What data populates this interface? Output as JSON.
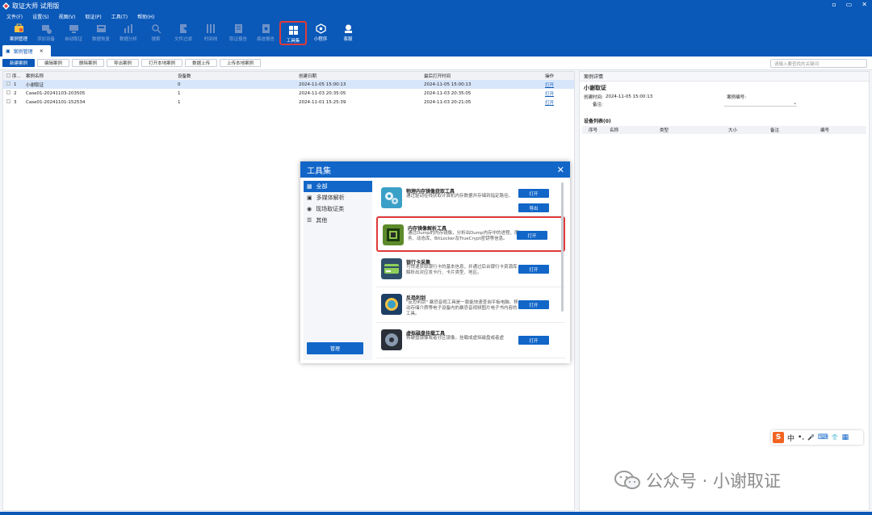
{
  "window": {
    "title": "取证大师 试用版",
    "controls": [
      "▫",
      "▭",
      "✕"
    ]
  },
  "menu": [
    "文件(F)",
    "设置(S)",
    "视图(V)",
    "取证(P)",
    "工具(T)",
    "帮助(H)"
  ],
  "toolbar": [
    {
      "label": "案例管理",
      "icon": "case-management-icon",
      "dim": false
    },
    {
      "label": "添加设备",
      "icon": "add-device-icon",
      "dim": true
    },
    {
      "label": "自动取证",
      "icon": "auto-forensics-icon",
      "dim": true
    },
    {
      "label": "数据恢复",
      "icon": "data-recovery-icon",
      "dim": true
    },
    {
      "label": "数据分析",
      "icon": "data-analysis-icon",
      "dim": true
    },
    {
      "label": "搜索",
      "icon": "search-icon",
      "dim": true
    },
    {
      "label": "文件过滤",
      "icon": "file-filter-icon",
      "dim": true
    },
    {
      "label": "时间线",
      "icon": "timeline-icon",
      "dim": true
    },
    {
      "label": "取证报告",
      "icon": "report-icon",
      "dim": true
    },
    {
      "label": "痕迹报告",
      "icon": "trace-report-icon",
      "dim": true
    },
    {
      "label": "工具集",
      "icon": "toolset-icon",
      "dim": false
    },
    {
      "label": "小程序",
      "icon": "miniprogram-icon",
      "dim": false
    },
    {
      "label": "客服",
      "icon": "customer-service-icon",
      "dim": false
    }
  ],
  "tab": {
    "label": "案例管理"
  },
  "actions": [
    "新建案例",
    "编辑案例",
    "删除案例",
    "导出案例",
    "打开本地案例",
    "数据上传",
    "上传本地案例"
  ],
  "search_placeholder": "请输入要查找的关键词",
  "case_table": {
    "columns": [
      "序...",
      "案例名称",
      "设备数",
      "创建日期",
      "最后打开时间",
      "操作"
    ],
    "rows": [
      [
        "1",
        "小谢取证",
        "0",
        "2024-11-05 15:00:13",
        "2024-11-05 15:00:13",
        "打开"
      ],
      [
        "2",
        "Case01-20241103-203505",
        "1",
        "2024-11-03 20:35:05",
        "2024-11-03 20:35:05",
        "打开"
      ],
      [
        "3",
        "Case01-20241101-152534",
        "1",
        "2024-11-01 15:25:39",
        "2024-11-03 20:21:05",
        "打开"
      ]
    ]
  },
  "detail": {
    "header": "案例详情",
    "name": "小谢取证",
    "created_label": "创建时间:",
    "created_value": "2024-11-05 15:00:13",
    "number_label": "案例编号:",
    "note_label": "备注:",
    "devices_label": "设备列表(0)",
    "device_columns": [
      "序号",
      "名称",
      "类型",
      "大小",
      "备注",
      "编号"
    ]
  },
  "dialog": {
    "title": "工具集",
    "categories": [
      {
        "label": "全部",
        "icon": "grid-icon"
      },
      {
        "label": "多媒体解析",
        "icon": "media-icon"
      },
      {
        "label": "现场取证类",
        "icon": "location-icon"
      },
      {
        "label": "其他",
        "icon": "list-icon"
      }
    ],
    "manage_label": "管理",
    "tools": [
      {
        "title": "物理内存镜像获取工具",
        "desc": "通过驱动在线获取计算机内存数据并存储到指定路径。",
        "open": "打开",
        "export": "导出",
        "icon": "gears-icon"
      },
      {
        "title": "内存镜像解析工具",
        "desc": "通过Dump的内存镜像，分析出Dump内存中的进程、服务、动态库、BitLocker及TrueCrypt密钥等信息。",
        "open": "打开",
        "icon": "memory-chip-icon"
      },
      {
        "title": "银行卡采集",
        "desc": "可快速获取银行卡的基本信息，并通过后台银行卡资源库解析出对应发卡行、卡片类型、地区。",
        "open": "打开",
        "icon": "bank-card-icon"
      },
      {
        "title": "反恐利剑",
        "desc": "\"反恐利剑\" 暴恐音视工具是一款能快速查询平板电脑、移动存储介质等电子设备内的暴恐音视频图片电子书内容的工具。",
        "open": "打开",
        "icon": "shield-icon"
      },
      {
        "title": "虚拟磁盘挂载工具",
        "desc": "将硬盘镜像或者分区镜像，挂载成虚拟磁盘或者虚",
        "open": "打开",
        "icon": "disk-mount-icon"
      }
    ]
  },
  "ime": {
    "items": [
      "中",
      "•,",
      "🎤",
      "⌨",
      "👕",
      "▦"
    ]
  },
  "watermark": {
    "text": "公众号 · 小谢取证"
  }
}
